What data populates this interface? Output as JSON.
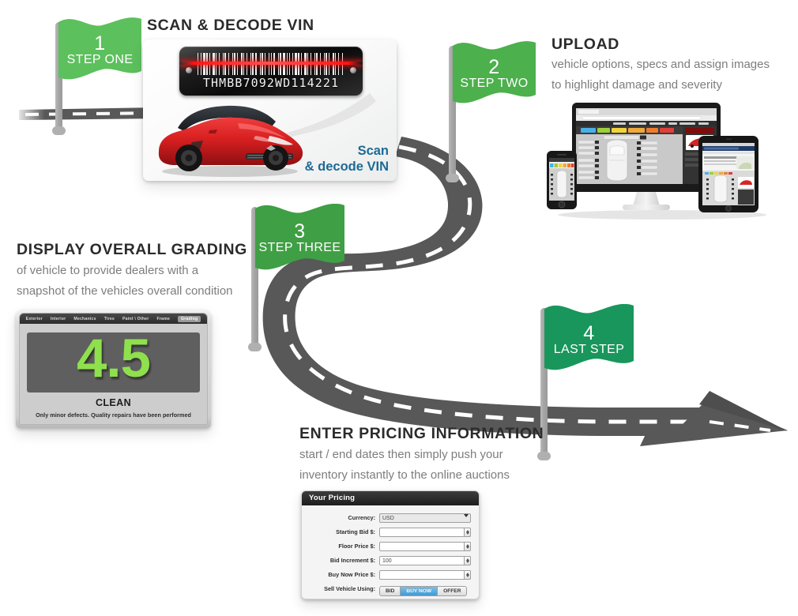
{
  "meta": {
    "title": "Vehicle Listing Workflow — 4 Steps"
  },
  "colors": {
    "flag1": "#5cc05c",
    "flag2": "#4cb04c",
    "flag3": "#3f9f44",
    "flag4": "#19965c",
    "road": "#585858",
    "road_dash": "#ffffff",
    "pole": "#a8a8a8",
    "heading": "#2b2b2b",
    "body_text": "#7d7d7d",
    "accent_blue": "#1b6a96",
    "grade_green": "#8fe04d",
    "laser_red": "#ff1414"
  },
  "steps": [
    {
      "number": "1",
      "flag_label": "STEP ONE",
      "heading": "SCAN & DECODE VIN",
      "body": []
    },
    {
      "number": "2",
      "flag_label": "STEP TWO",
      "heading": "UPLOAD",
      "body": [
        "vehicle options, specs and assign images",
        "to highlight damage and severity"
      ]
    },
    {
      "number": "3",
      "flag_label": "STEP THREE",
      "heading": "DISPLAY OVERALL GRADING",
      "body": [
        "of vehicle to provide dealers with a",
        "snapshot of the vehicles overall condition"
      ]
    },
    {
      "number": "4",
      "flag_label": "LAST STEP",
      "heading": "ENTER PRICING INFORMATION",
      "body": [
        "start / end dates then simply push your",
        "inventory instantly to the online auctions"
      ]
    }
  ],
  "vin_card": {
    "vin": "THMBB7092WD114221",
    "scan_line_1": "Scan",
    "scan_line_2": "& decode VIN"
  },
  "grading": {
    "tabs": [
      "Exterior",
      "Interior",
      "Mechanics",
      "Tires",
      "Paint \\ Other",
      "Frame",
      "Grading"
    ],
    "active_tab": "Grading",
    "score": "4.5",
    "status": "CLEAN",
    "note": "Only minor defects. Quality repairs have been performed"
  },
  "pricing": {
    "window_title": "Your Pricing",
    "rows": [
      {
        "label": "Currency:",
        "value": "USD",
        "control": "select"
      },
      {
        "label": "Starting Bid $:",
        "value": "",
        "control": "stepper"
      },
      {
        "label": "Floor Price $:",
        "value": "",
        "control": "stepper"
      },
      {
        "label": "Bid Increment $:",
        "value": "100",
        "control": "stepper"
      },
      {
        "label": "Buy Now Price $:",
        "value": "",
        "control": "stepper"
      }
    ],
    "sell_label": "Sell Vehicle Using:",
    "sell_options": [
      "BID",
      "BUY NOW",
      "OFFER"
    ],
    "sell_selected": "BUY NOW"
  },
  "icons": {
    "cursor": "pointer-hand-icon",
    "barcode": "barcode-icon",
    "laser": "laser-scan-line-icon",
    "car": "sports-car-icon",
    "monitor": "desktop-monitor-icon",
    "tablet": "tablet-icon",
    "phone": "smartphone-icon",
    "road": "winding-road-icon",
    "arrow": "road-arrow-icon"
  }
}
